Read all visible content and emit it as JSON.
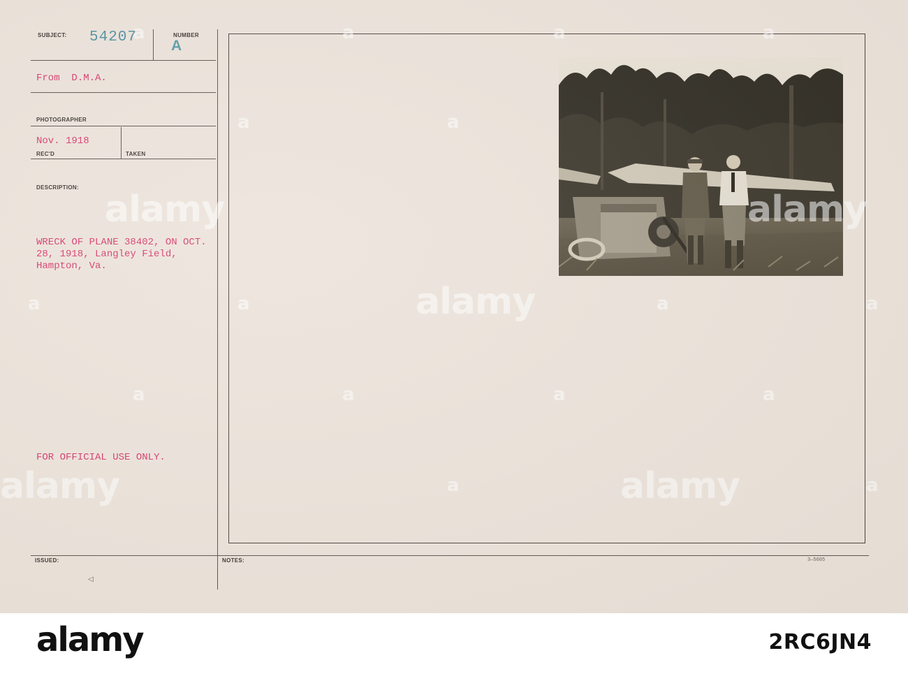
{
  "card": {
    "subject_label": "SUBJECT:",
    "subject_number": "54207",
    "number_label": "NUMBER",
    "number_value": "A",
    "from": "From  D.M.A.",
    "photographer_label": "PHOTOGRAPHER",
    "recd_date": "Nov. 1918",
    "recd_label": "REC'D",
    "taken_label": "TAKEN",
    "description_label": "DESCRIPTION:",
    "description_lines": [
      "WRECK OF PLANE 38402, ON OCT.",
      "28, 1918, Langley Field,",
      "Hampton, Va."
    ],
    "official_use": "FOR OFFICIAL USE ONLY.",
    "issued_label": "ISSUED:",
    "notes_label": "NOTES:",
    "triangle_mark": "◁",
    "form_code": "3—5605"
  },
  "watermark": {
    "text": "alamy",
    "letter": "a"
  },
  "footer": {
    "logo": "alamy",
    "image_id": "2RC6JN4"
  },
  "colors": {
    "card_bg": "#ece3da",
    "typed_red": "#d7376b",
    "stamp_blue": "#4e8fa0",
    "rule": "#5b534e"
  }
}
